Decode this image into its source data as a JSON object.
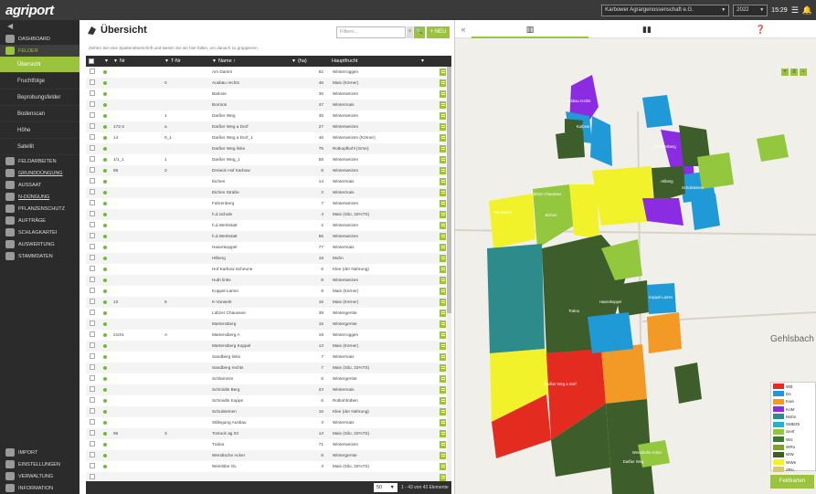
{
  "app": {
    "logo": "agriport"
  },
  "topbar": {
    "company": "Karbower Agrargenossenschaft e.G.",
    "year": "2022",
    "time": "15:29"
  },
  "sidebar": {
    "top": [
      {
        "label": "DASHBOARD",
        "icon": "home-icon"
      },
      {
        "label": "FELDER",
        "icon": "tractor-icon",
        "active": true
      }
    ],
    "sub": [
      {
        "label": "Übersicht",
        "active": true
      },
      {
        "label": "Fruchtfolge"
      },
      {
        "label": "Beprobungsfelder"
      },
      {
        "label": "Bodenscan"
      },
      {
        "label": "Höhe"
      },
      {
        "label": "Satellit"
      }
    ],
    "main": [
      {
        "label": "FELDARBEITEN",
        "icon": "field-work-icon"
      },
      {
        "label": "GRUNDDÜNGUNG",
        "icon": "fertilizer-icon",
        "underline": true
      },
      {
        "label": "AUSSAAT",
        "icon": "seed-icon"
      },
      {
        "label": "N-DÜNGUNG",
        "icon": "nitrogen-icon",
        "underline": true
      },
      {
        "label": "PFLANZENSCHUTZ",
        "icon": "plant-protection-icon"
      },
      {
        "label": "AUFTRÄGE",
        "icon": "orders-icon"
      },
      {
        "label": "SCHLAGKARTEI",
        "icon": "field-index-icon"
      },
      {
        "label": "AUSWERTUNG",
        "icon": "evaluation-icon"
      },
      {
        "label": "STAMMDATEN",
        "icon": "master-data-icon"
      }
    ],
    "bottom": [
      {
        "label": "IMPORT",
        "icon": "import-icon"
      },
      {
        "label": "EINSTELLUNGEN",
        "icon": "settings-icon"
      },
      {
        "label": "VERWALTUNG",
        "icon": "admin-icon"
      },
      {
        "label": "INFORMATION",
        "icon": "info-icon"
      }
    ]
  },
  "panel": {
    "title": "Übersicht",
    "filter_placeholder": "Filtern...",
    "new_label": "+ NEU",
    "hint": "Ziehen Sie eine Spaltenüberschrift und lassen Sie sie hier fallen, um danach zu gruppieren.",
    "columns": [
      "Nr",
      "T-Nr",
      "Name ↑",
      "(ha)",
      "Hauptfrucht"
    ],
    "rows": [
      [
        "",
        "",
        "Am Damm",
        "82",
        "Winterroggen"
      ],
      [
        "",
        "0",
        "Ausbau rechts",
        "46",
        "Mais (Körner)"
      ],
      [
        "",
        "",
        "Barlose",
        "36",
        "Winterweizen"
      ],
      [
        "",
        "",
        "Borntos",
        "47",
        "Wintermais"
      ],
      [
        "",
        "1",
        "Darßer Weg",
        "35",
        "Winterweizen"
      ],
      [
        "172-2",
        "a",
        "Darßer Weg a Dorf",
        "27",
        "Winterweizen"
      ],
      [
        "14",
        "0_1",
        "Darßer Weg a Dorf_1",
        "46",
        "Winterweizen (Körner)"
      ],
      [
        "",
        "",
        "Darßer Weg links",
        "75",
        "Rotkopfkohl (Grün)"
      ],
      [
        "1/1_1",
        "1",
        "Darßer Weg_1",
        "55",
        "Winterweizen"
      ],
      [
        "86",
        "2",
        "Dreieck Hof Karbow",
        "8",
        "Winterweizen"
      ],
      [
        "",
        "",
        "Eichen",
        "14",
        "Wintermais"
      ],
      [
        "",
        "",
        "Eichen Straße",
        "3",
        "Wintermais"
      ],
      [
        "",
        "",
        "Fahrenberg",
        "7",
        "Winterweizen"
      ],
      [
        "",
        "",
        "h.d.Schule",
        "4",
        "Mais (Silo, 32%TS)"
      ],
      [
        "",
        "",
        "h.d.Werkstatt",
        "2",
        "Winterweizen"
      ],
      [
        "",
        "",
        "h.d.Werkstatt",
        "55",
        "Winterweizen"
      ],
      [
        "",
        "",
        "Hasenkoppel",
        "77",
        "Wintermais"
      ],
      [
        "",
        "",
        "Hilberg",
        "18",
        "Mohn"
      ],
      [
        "",
        "",
        "Hof Karbow Scheune",
        "6",
        "Klee (der Nahrung)"
      ],
      [
        "",
        "",
        "Huth links",
        "8",
        "Winterweizen"
      ],
      [
        "",
        "",
        "Koppel Lamm",
        "9",
        "Mais (Körner)"
      ],
      [
        "12",
        "5",
        "K-Vorwerk",
        "15",
        "Mais (Körner)"
      ],
      [
        "",
        "",
        "Lübzer Chaussee",
        "38",
        "Wintergerste"
      ],
      [
        "",
        "",
        "Martensberg",
        "15",
        "Wintergerste"
      ],
      [
        "210/1",
        "A",
        "Martensberg A",
        "19",
        "Winterroggen"
      ],
      [
        "",
        "",
        "Martensberg Koppel",
        "13",
        "Mais (Körner)"
      ],
      [
        "",
        "",
        "Sandberg links",
        "7",
        "Wintermais"
      ],
      [
        "",
        "",
        "Sandberg rechts",
        "7",
        "Mais (Silo, 32%TS)"
      ],
      [
        "",
        "",
        "Schlammin",
        "5",
        "Wintergerste"
      ],
      [
        "",
        "",
        "Schmidts Berg",
        "23",
        "Wintermais"
      ],
      [
        "",
        "",
        "Schmidts Koppe",
        "6",
        "Rotkohlrüben"
      ],
      [
        "",
        "",
        "Schulsteinen",
        "16",
        "Klee (der Nahrung)"
      ],
      [
        "",
        "",
        "Stillegung Ausbau",
        "3",
        "Wintermais"
      ],
      [
        "96",
        "3",
        "Tostock ag 03",
        "13",
        "Mais (Silo, 32%TS)"
      ],
      [
        "",
        "",
        "Tralna",
        "71",
        "Winterweizen"
      ],
      [
        "",
        "",
        "Wendische Acker",
        "8",
        "Wintergerste"
      ],
      [
        "",
        "",
        "Weinlöbe OL",
        "3",
        "Mais (Silo, 32%TS)"
      ],
      [
        "",
        "",
        "",
        "",
        ""
      ]
    ],
    "pager": {
      "size": "50",
      "info": "1 - 43 von 43 Elemente"
    }
  },
  "map": {
    "tabs": [
      {
        "icon": "map-icon"
      },
      {
        "icon": "chart-icon"
      },
      {
        "icon": "help-icon"
      }
    ],
    "town_label": "Gehlsbach",
    "legend": [
      {
        "label": "WB",
        "color": "#e32b1f"
      },
      {
        "label": "Ds",
        "color": "#1f9ad6"
      },
      {
        "label": "Kwe",
        "color": "#f29a25"
      },
      {
        "label": "KoM",
        "color": "#8b2be2"
      },
      {
        "label": "Mohn",
        "color": "#2e8b8b"
      },
      {
        "label": "SMB25",
        "color": "#1fb1d6"
      },
      {
        "label": "Senf",
        "color": "#93c83e"
      },
      {
        "label": "Wtc",
        "color": "#3a7a2e"
      },
      {
        "label": "WRo",
        "color": "#7fa32a"
      },
      {
        "label": "WW",
        "color": "#3d5e2a"
      },
      {
        "label": "WWe",
        "color": "#f1f22a"
      },
      {
        "label": "ZRü",
        "color": "#d9c96a"
      }
    ],
    "fields_button": "Feldkarten",
    "field_labels": [
      "Ausbau rechts",
      "Karbow",
      "Am Damm",
      "Eichen",
      "Hilberg",
      "Lübzer Chaussee",
      "Martensberg",
      "Darßer Weg a Dorf",
      "Darßer Weg",
      "Wendische Acker",
      "Hasenkoppel",
      "Koppel Lamm",
      "Schulsteinen",
      "Tralna"
    ]
  }
}
